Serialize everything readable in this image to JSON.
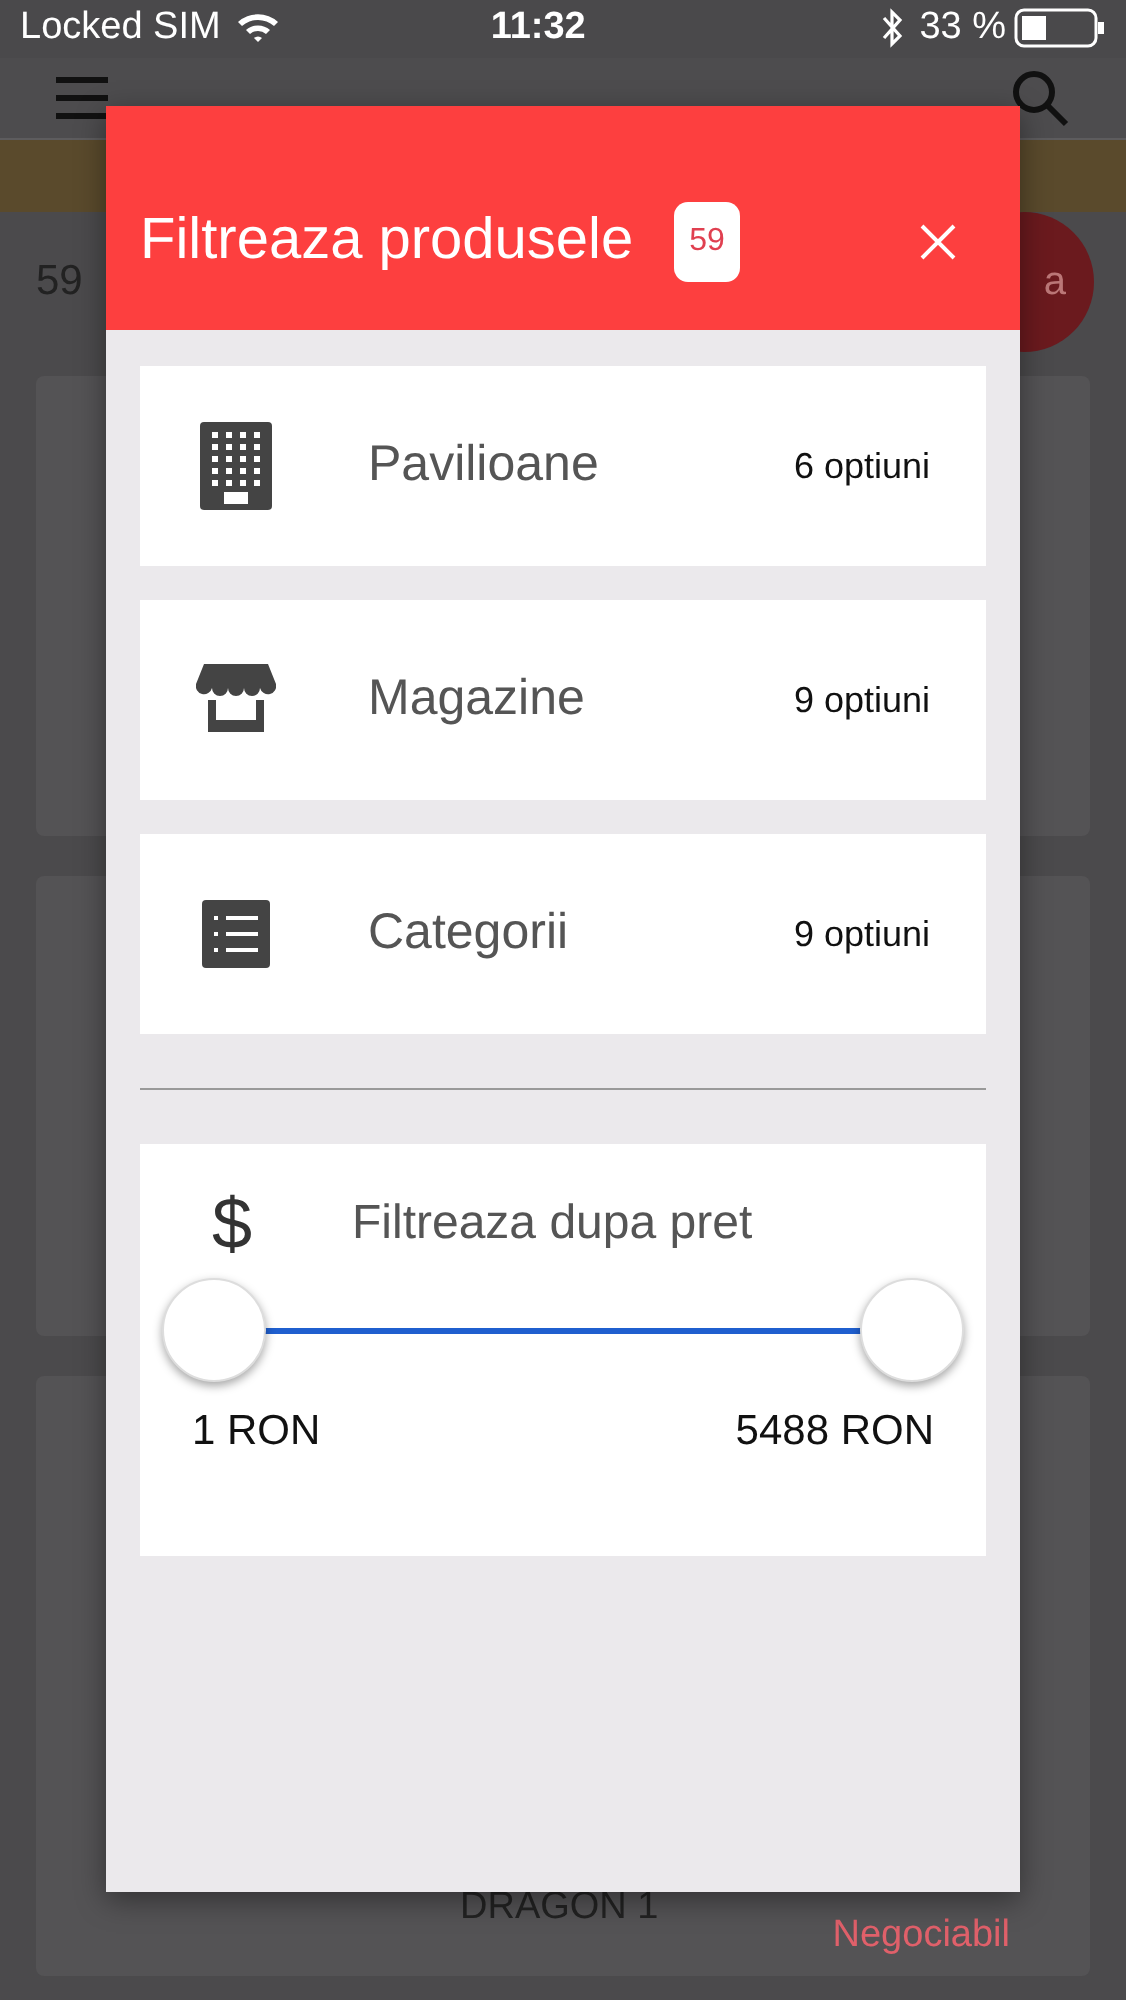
{
  "status_bar": {
    "carrier": "Locked SIM",
    "time": "11:32",
    "battery": "33 %"
  },
  "background": {
    "count": "59",
    "action_button": "a",
    "product_name": "DRAGON 1",
    "price_note": "Negociabil"
  },
  "filter_dialog": {
    "title": "Filtreaza produsele",
    "badge": "59",
    "sections": [
      {
        "kind": "building",
        "label": "Pavilioane",
        "count": "6 optiuni"
      },
      {
        "kind": "store",
        "label": "Magazine",
        "count": "9 optiuni"
      },
      {
        "kind": "list",
        "label": "Categorii",
        "count": "9 optiuni"
      }
    ],
    "price_filter": {
      "icon": "$",
      "label": "Filtreaza dupa pret",
      "min_label": "1 RON",
      "max_label": "5488 RON"
    }
  }
}
